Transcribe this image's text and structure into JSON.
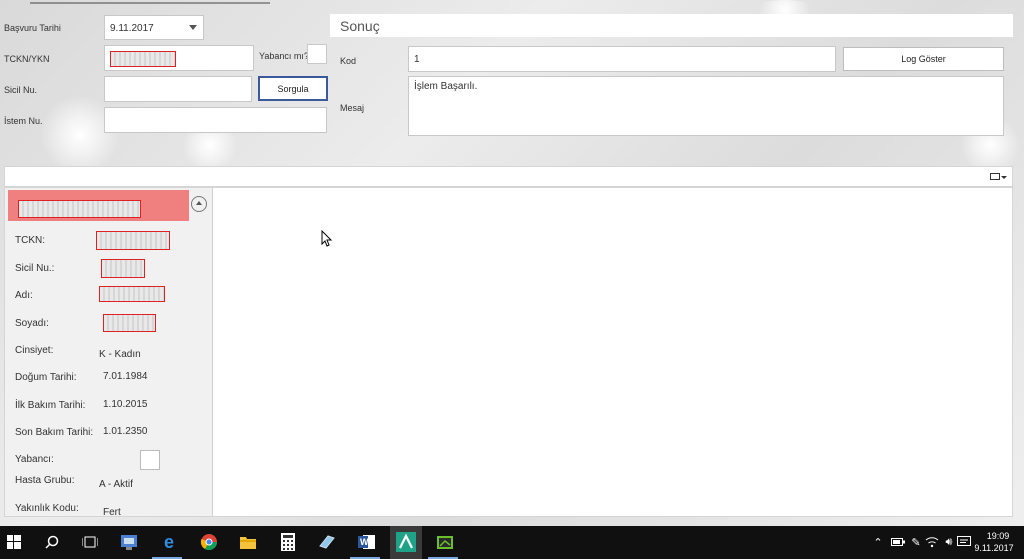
{
  "form": {
    "basvuru_label": "Başvuru Tarihi",
    "basvuru_value": "9.11.2017",
    "tckn_label": "TCKN/YKN",
    "yabanci_label": "Yabancı mı?",
    "sicil_label": "Sicil Nu.",
    "sorgula_label": "Sorgula",
    "istem_label": "İstem Nu."
  },
  "result": {
    "title": "Sonuç",
    "kod_label": "Kod",
    "kod_value": "1",
    "log_button": "Log Göster",
    "mesaj_label": "Mesaj",
    "mesaj_value": "İşlem Başarılı."
  },
  "patient": {
    "fields": [
      {
        "label": "TCKN:",
        "value": ""
      },
      {
        "label": "Sicil Nu.:",
        "value": ""
      },
      {
        "label": "Adı:",
        "value": ""
      },
      {
        "label": "Soyadı:",
        "value": ""
      },
      {
        "label": "Cinsiyet:",
        "value": "K - Kadın"
      },
      {
        "label": "Doğum Tarihi:",
        "value": "7.01.1984"
      },
      {
        "label": "İlk Bakım Tarihi:",
        "value": "1.10.2015"
      },
      {
        "label": "Son Bakım Tarihi:",
        "value": "1.01.2350"
      },
      {
        "label": "Yabancı:",
        "value": ""
      },
      {
        "label": "Hasta Grubu:",
        "value": "A - Aktif"
      },
      {
        "label": "Yakınlık Kodu:",
        "value": "Fert"
      }
    ]
  },
  "taskbar": {
    "time": "19:09",
    "date": "9.11.2017"
  },
  "colors": {
    "header_red": "#f08080",
    "taskbar": "#101010",
    "focus_border": "#3a5a9a"
  }
}
